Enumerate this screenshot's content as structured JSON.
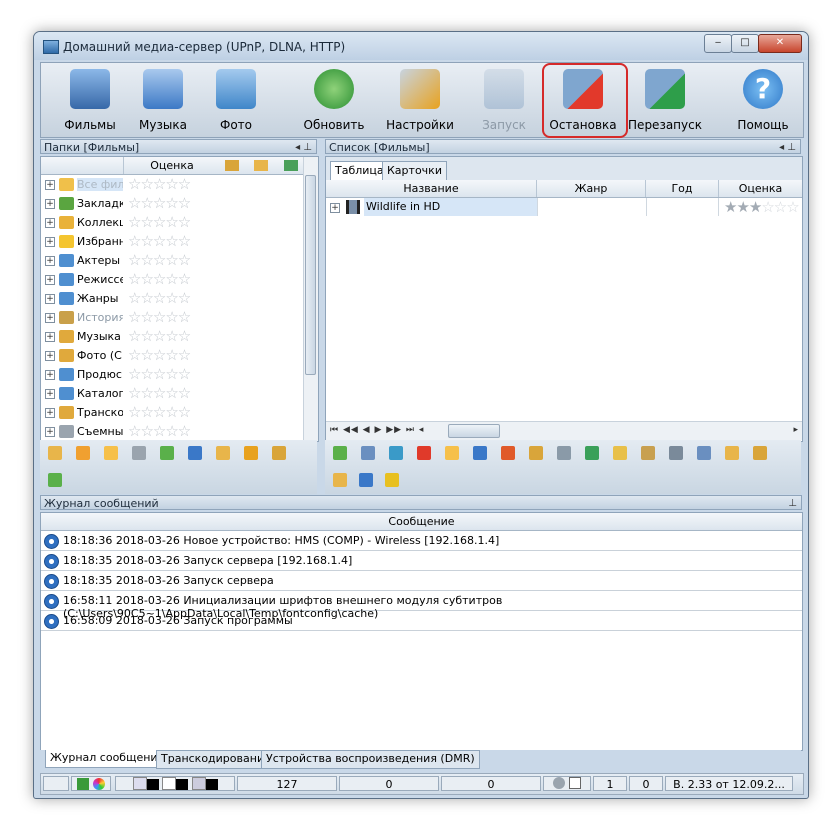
{
  "window": {
    "title": "Домашний медиа-сервер (UPnP, DLNA, HTTP)",
    "minimize": "‒",
    "maximize": "□",
    "close": "✕"
  },
  "toolbar": {
    "buttons": [
      {
        "label": "Фильмы",
        "icon": "film-icon",
        "color": "#4a7fc0",
        "disabled": false
      },
      {
        "label": "Музыка",
        "icon": "music-icon",
        "color": "#3c79c6",
        "disabled": false
      },
      {
        "label": "Фото",
        "icon": "photo-icon",
        "color": "#3f86c9",
        "disabled": false
      },
      {
        "label": "Обновить",
        "icon": "refresh-icon",
        "color": "#3aa23c",
        "disabled": false
      },
      {
        "label": "Настройки",
        "icon": "settings-icon",
        "color": "#e8a21f",
        "disabled": false
      },
      {
        "label": "Запуск",
        "icon": "start-icon",
        "color": "#7a9bbf",
        "disabled": true
      },
      {
        "label": "Остановка",
        "icon": "stop-icon",
        "color": "#d9342b",
        "disabled": false
      },
      {
        "label": "Перезапуск",
        "icon": "restart-icon",
        "color": "#2e9e4a",
        "disabled": false
      },
      {
        "label": "Помощь",
        "icon": "help-icon",
        "color": "#2f88d6",
        "disabled": false
      }
    ]
  },
  "folders": {
    "header": "Папки [Фильмы]",
    "pin": "◂ ⊥",
    "column_rating": "Оценка",
    "items": [
      {
        "label": "Все фил",
        "icon": "folder-open-icon",
        "color": "#f0c04a",
        "state": "sel"
      },
      {
        "label": "Закладк",
        "icon": "bookmarks-icon",
        "color": "#5aa540",
        "state": ""
      },
      {
        "label": "Коллекц",
        "icon": "collection-icon",
        "color": "#e9b23a",
        "state": ""
      },
      {
        "label": "Избранн",
        "icon": "star-folder-icon",
        "color": "#f4c530",
        "state": ""
      },
      {
        "label": "Актеры",
        "icon": "actors-folder-icon",
        "color": "#4f8fd0",
        "state": ""
      },
      {
        "label": "Режиссе",
        "icon": "directors-folder-icon",
        "color": "#4f8fd0",
        "state": ""
      },
      {
        "label": "Жанры",
        "icon": "genres-folder-icon",
        "color": "#4f8fd0",
        "state": ""
      },
      {
        "label": "История",
        "icon": "history-folder-icon",
        "color": "#c9a04a",
        "state": "dim"
      },
      {
        "label": "Музыка",
        "icon": "music-folder-icon",
        "color": "#e0a93c",
        "state": ""
      },
      {
        "label": "Фото (С",
        "icon": "photo-folder-icon",
        "color": "#e0a93c",
        "state": ""
      },
      {
        "label": "Продюс",
        "icon": "producers-folder-icon",
        "color": "#4f8fd0",
        "state": ""
      },
      {
        "label": "Каталог",
        "icon": "catalog-folder-icon",
        "color": "#4f8fd0",
        "state": ""
      },
      {
        "label": "Транско",
        "icon": "transcode-folder-icon",
        "color": "#e0a93c",
        "state": ""
      },
      {
        "label": "Съемны",
        "icon": "removable-icon",
        "color": "#9aa4ae",
        "state": ""
      }
    ]
  },
  "list": {
    "header": "Список [Фильмы]",
    "pin": "◂ ⊥",
    "tabs": [
      "Таблица",
      "Карточки"
    ],
    "columns": [
      "Название",
      "Жанр",
      "Год",
      "Оценка"
    ],
    "rows": [
      {
        "name": "Wildlife in HD",
        "genre": "",
        "year": "",
        "rating": 3
      }
    ],
    "scroll_nav": "⏮ ◀◀ ◀ ▶ ▶▶ ⏭ ◂",
    "scroll_right": "▸"
  },
  "log": {
    "header": "Журнал сообщений",
    "pin": "⊥",
    "column": "Сообщение",
    "rows": [
      "18:18:36 2018-03-26 Новое устройство: HMS (COMP) - Wireless [192.168.1.4]",
      "18:18:35 2018-03-26 Запуск сервера [192.168.1.4]",
      "18:18:35 2018-03-26 Запуск сервера",
      "16:58:11 2018-03-26 Инициализации шрифтов внешнего модуля субтитров (C:\\Users\\90C5~1\\AppData\\Local\\Temp\\fontconfig\\cache)",
      "16:58:09 2018-03-26 Запуск программы"
    ]
  },
  "bottom_tabs": [
    "Журнал сообщений",
    "Транскодирование",
    "Устройства воспроизведения (DMR)"
  ],
  "status": {
    "count": "127",
    "c2": "0",
    "c3": "0",
    "c4": "1",
    "c5": "0",
    "version": "В. 2.33 от 12.09.2..."
  }
}
